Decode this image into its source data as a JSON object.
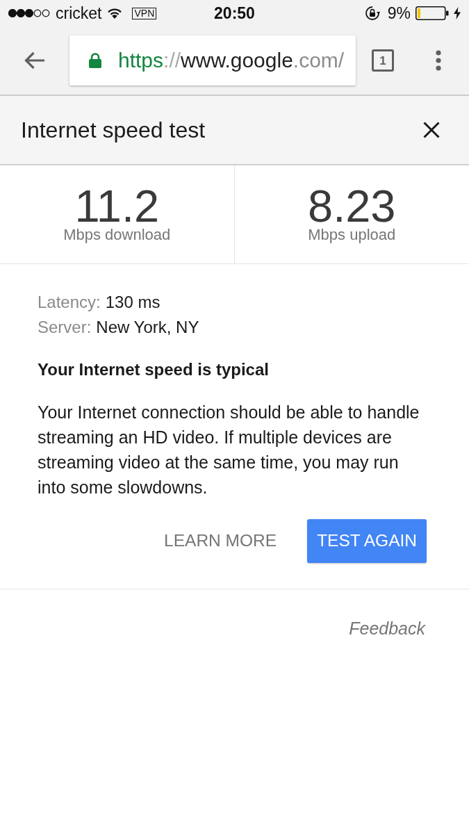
{
  "status_bar": {
    "carrier": "cricket",
    "vpn": "VPN",
    "time": "20:50",
    "battery_percent": "9%"
  },
  "browser_toolbar": {
    "url": [
      {
        "text": "https",
        "kind": "scheme"
      },
      {
        "text": "://",
        "kind": "separator"
      },
      {
        "text": "www.google",
        "kind": "host"
      },
      {
        "text": ".com/",
        "kind": "path"
      }
    ],
    "tab_count": "1"
  },
  "card": {
    "title": "Internet speed test",
    "results": [
      {
        "value": "11.2",
        "label": "Mbps download"
      },
      {
        "value": "8.23",
        "label": "Mbps upload"
      }
    ],
    "details": [
      {
        "label": "Latency:",
        "value": "130 ms"
      },
      {
        "label": "Server:",
        "value": "New York, NY"
      }
    ],
    "heading": "Your Internet speed is typical",
    "description": "Your Internet connection should be able to handle streaming an HD video. If multiple devices are streaming video at the same time, you may run into some slowdowns.",
    "buttons": [
      {
        "label": "LEARN MORE",
        "kind": "text"
      },
      {
        "label": "TEST AGAIN",
        "kind": "primary"
      }
    ],
    "feedback": "Feedback"
  }
}
